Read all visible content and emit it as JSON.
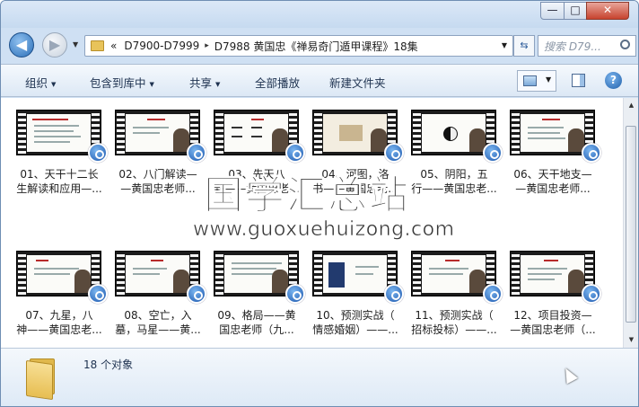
{
  "window": {
    "minimize": "—",
    "maximize": "□",
    "close": "✕"
  },
  "nav": {
    "back": "◀",
    "forward": "▶",
    "history": "▼"
  },
  "address": {
    "more": "«",
    "crumbs": [
      "D7900-D7999",
      "D7988 黄国忠《禅易奇门遁甲课程》18集"
    ],
    "separator": "▸",
    "dropdown": "▼",
    "refresh": "⇆"
  },
  "search": {
    "placeholder": "搜索 D79..."
  },
  "toolbar": {
    "organize": "组织",
    "include": "包含到库中",
    "share": "共享",
    "playall": "全部播放",
    "newfolder": "新建文件夹",
    "arrow": "▼",
    "help": "?"
  },
  "files": [
    {
      "line1": "01、天干十二长",
      "line2": "生解读和应用—..."
    },
    {
      "line1": "02、八门解读—",
      "line2": "—黄国忠老师..."
    },
    {
      "line1": "03、先天八",
      "line2": "卦——黄国忠老..."
    },
    {
      "line1": "04、河图，洛",
      "line2": "书——黄国忠老..."
    },
    {
      "line1": "05、阴阳，五",
      "line2": "行——黄国忠老..."
    },
    {
      "line1": "06、天干地支—",
      "line2": "—黄国忠老师..."
    },
    {
      "line1": "07、九星，八",
      "line2": "神——黄国忠老..."
    },
    {
      "line1": "08、空亡，入",
      "line2": "墓，马星——黄..."
    },
    {
      "line1": "09、格局——黄",
      "line2": "国忠老师（九..."
    },
    {
      "line1": "10、预测实战（",
      "line2": "情感婚姻）——..."
    },
    {
      "line1": "11、预测实战（",
      "line2": "招标投标）——..."
    },
    {
      "line1": "12、项目投资—",
      "line2": "—黄国忠老师（..."
    }
  ],
  "watermark": {
    "chinese": "国学汇总站",
    "url": "www.guoxuehuizong.com"
  },
  "details": {
    "count": "18 个对象"
  },
  "scroll": {
    "up": "▲",
    "down": "▼"
  },
  "colors": {
    "accent": "#1b56ad",
    "close_button": "#c7432e",
    "folder": "#e7be52"
  }
}
